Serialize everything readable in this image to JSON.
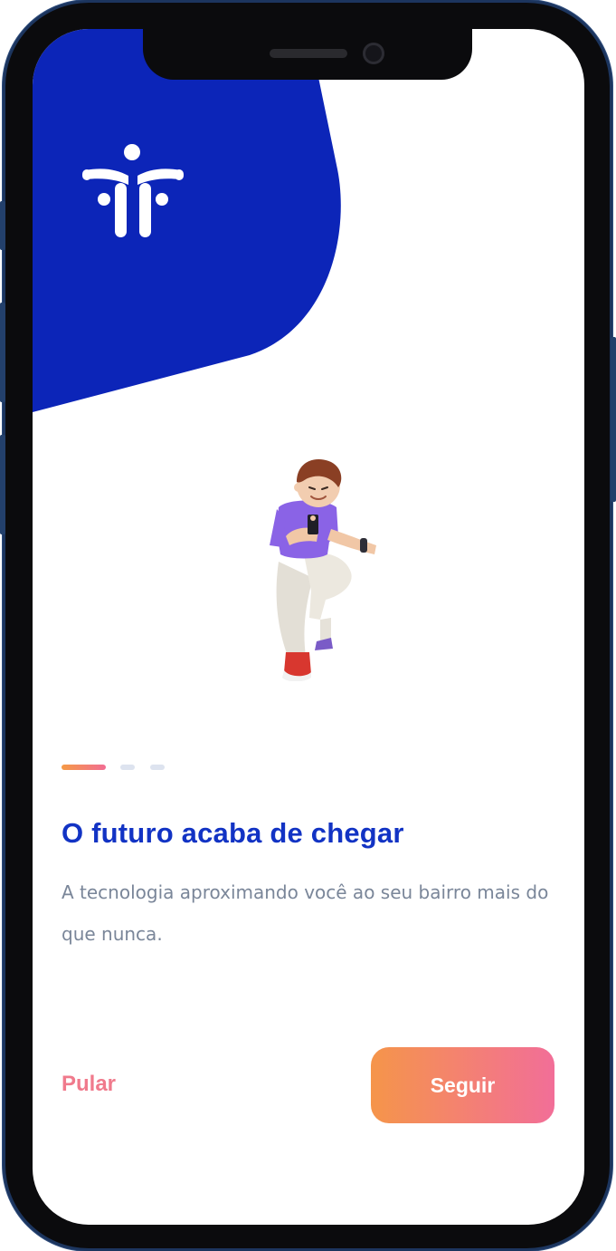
{
  "colors": {
    "brand_blue": "#0c25b8",
    "title_blue": "#1233c4",
    "accent_gradient_start": "#f5954a",
    "accent_gradient_end": "#f26e98",
    "muted_text": "#7a8699"
  },
  "logo": {
    "icon": "community-people-icon"
  },
  "illustration": {
    "icon": "person-with-phone-illustration"
  },
  "pager": {
    "total": 3,
    "active": 1
  },
  "onboarding": {
    "title": "O futuro acaba de chegar",
    "subtitle": "A tecnologia aproximando você ao seu bairro mais do que nunca."
  },
  "actions": {
    "skip_label": "Pular",
    "next_label": "Seguir"
  }
}
